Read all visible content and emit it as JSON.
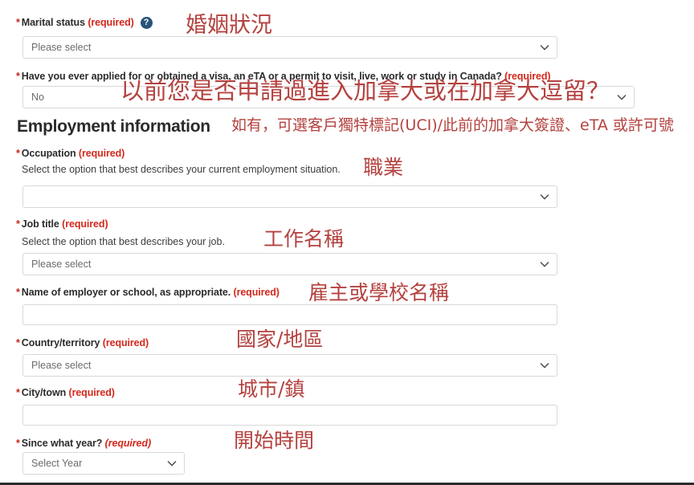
{
  "form": {
    "marital_status": {
      "label": "Marital status",
      "required_tag": "(required)",
      "help_icon": "help-circle-icon",
      "select_value": "Please select",
      "annotation": "婚姻狀況"
    },
    "previous_visa": {
      "label": "Have you ever applied for or obtained a visa, an eTA or a permit to visit, live, work or study in Canada?",
      "required_tag": "(required)",
      "select_value": "No",
      "annotation": "以前您是否申請過進入加拿大或在加拿大逗留？"
    },
    "employment_section": {
      "heading": "Employment information",
      "annotation": "如有，可選客戶獨特標記(UCI)/此前的加拿大簽證、eTA 或許可號"
    },
    "occupation": {
      "label": "Occupation",
      "required_tag": "(required)",
      "hint": "Select the option that best describes your current employment situation.",
      "select_value": "",
      "annotation": "職業"
    },
    "job_title": {
      "label": "Job title",
      "required_tag": "(required)",
      "hint": "Select the option that best describes your job.",
      "select_value": "Please select",
      "annotation": "工作名稱"
    },
    "employer_name": {
      "label": "Name of employer or school, as appropriate.",
      "required_tag": "(required)",
      "input_value": "",
      "annotation": "雇主或學校名稱"
    },
    "country": {
      "label": "Country/territory",
      "required_tag": "(required)",
      "select_value": "Please select",
      "annotation": "國家/地區"
    },
    "city": {
      "label": "City/town",
      "required_tag": "(required)",
      "input_value": "",
      "annotation": "城市/鎮"
    },
    "since_year": {
      "label": "Since what year?",
      "required_tag": "(required)",
      "select_value": "Select Year",
      "annotation": "開始時間"
    }
  },
  "colors": {
    "required_red": "#d3281c",
    "annotation_red": "#b4423f",
    "help_icon_navy": "#29527a",
    "border_grey": "#d8d8d8",
    "text_dark": "#2b2b2b"
  }
}
